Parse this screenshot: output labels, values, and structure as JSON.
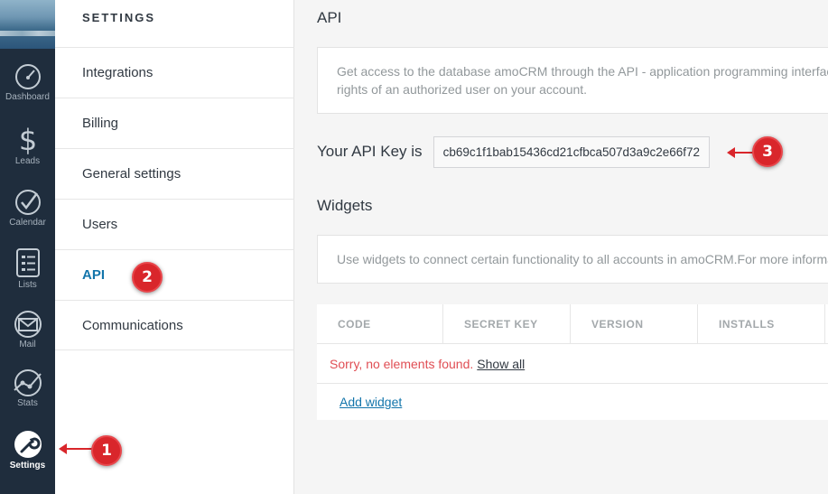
{
  "nav": {
    "items": [
      {
        "label": "Dashboard",
        "icon": "dashboard-icon"
      },
      {
        "label": "Leads",
        "icon": "dollar-icon"
      },
      {
        "label": "Calendar",
        "icon": "check-circle-icon"
      },
      {
        "label": "Lists",
        "icon": "list-icon"
      },
      {
        "label": "Mail",
        "icon": "mail-icon"
      },
      {
        "label": "Stats",
        "icon": "stats-icon"
      },
      {
        "label": "Settings",
        "icon": "wrench-icon",
        "active": true
      }
    ]
  },
  "settings_menu": {
    "title": "SETTINGS",
    "items": [
      {
        "label": "Integrations"
      },
      {
        "label": "Billing"
      },
      {
        "label": "General settings"
      },
      {
        "label": "Users"
      },
      {
        "label": "API",
        "active": true
      },
      {
        "label": "Communications"
      }
    ]
  },
  "api": {
    "title": "API",
    "description_line1": "Get access to the database amoCRM through the API - application programming interface",
    "description_line2": "rights of an authorized user on your account.",
    "key_label": "Your API Key is",
    "key_value": "cb69c1f1bab15436cd21cfbca507d3a9c2e66f72"
  },
  "widgets": {
    "title": "Widgets",
    "description": "Use widgets to connect certain functionality to all accounts in amoCRM.For more information",
    "columns": [
      "CODE",
      "SECRET KEY",
      "VERSION",
      "INSTALLS"
    ],
    "empty_message": "Sorry, no elements found.",
    "show_all": "Show all",
    "add_widget": "Add widget"
  },
  "callouts": [
    "1",
    "2",
    "3"
  ],
  "colors": {
    "rail_bg": "#1f2d3d",
    "accent": "#1375ab",
    "error": "#e04e54",
    "callout": "#d9262b"
  }
}
